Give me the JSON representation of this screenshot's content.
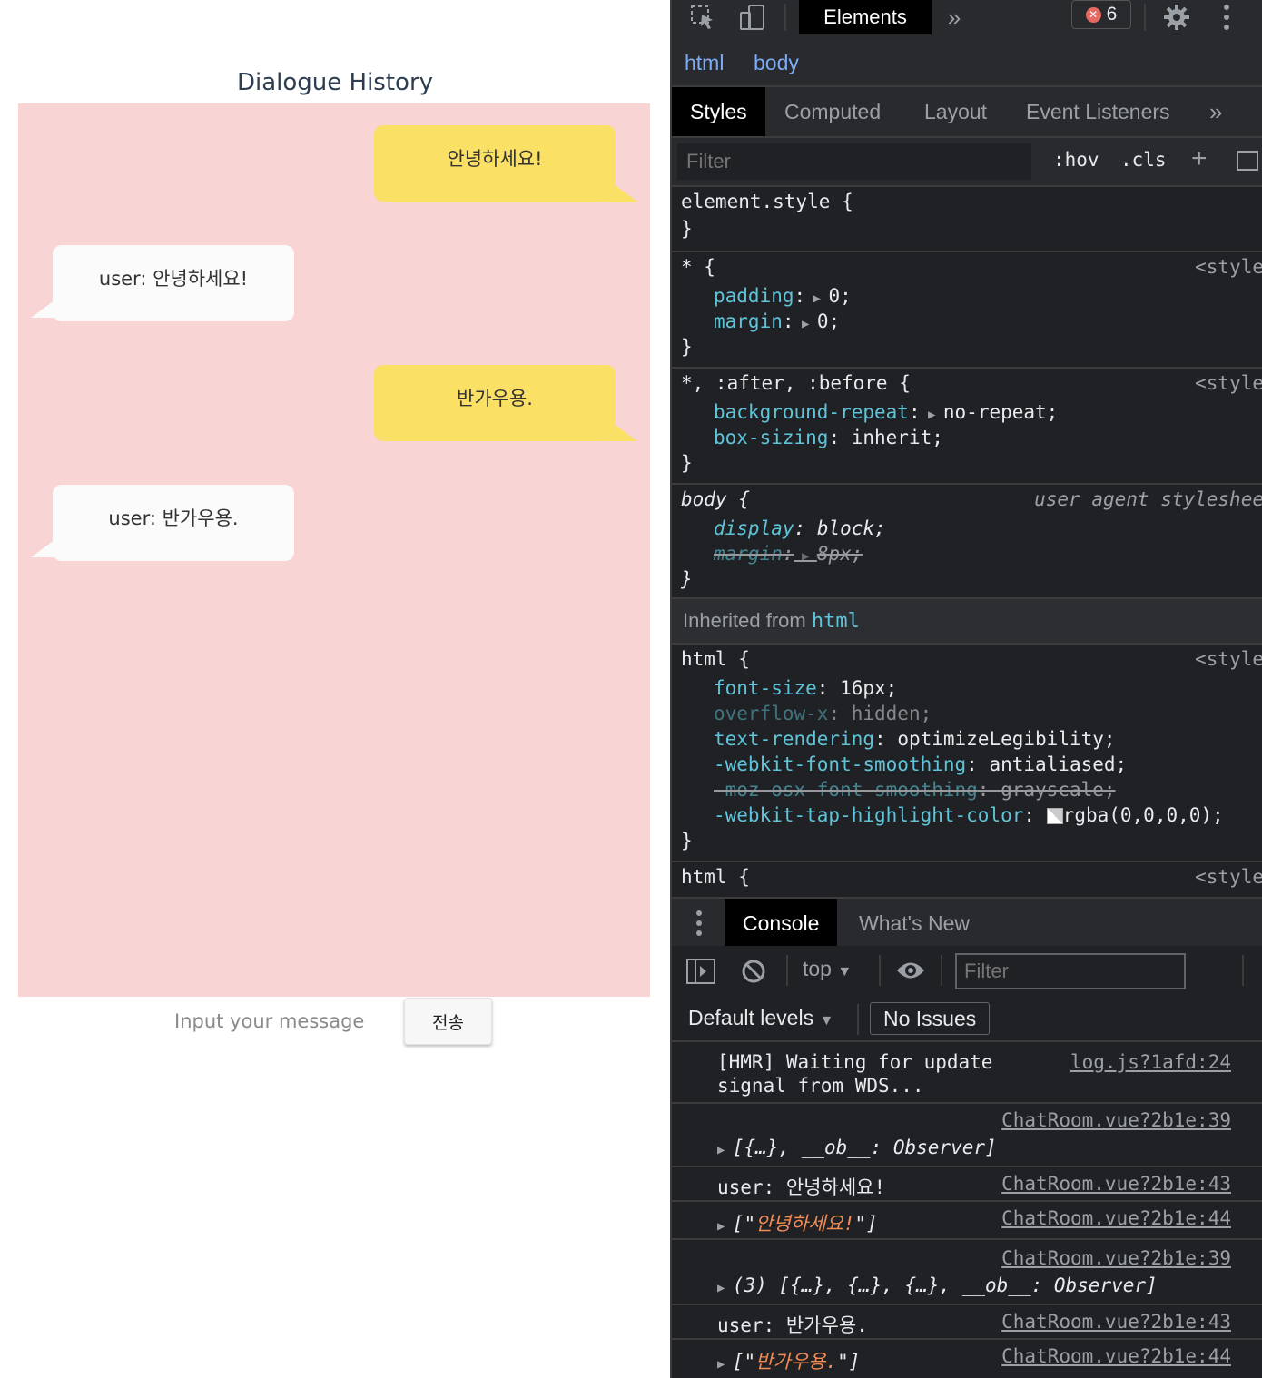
{
  "app": {
    "title": "Dialogue History",
    "messages": [
      {
        "side": "mine",
        "text": "안녕하세요!"
      },
      {
        "side": "other",
        "text": "user: 안녕하세요!"
      },
      {
        "side": "mine",
        "text": "반가우용."
      },
      {
        "side": "other",
        "text": "user: 반가우용."
      }
    ],
    "input_placeholder": "Input your message",
    "send_label": "전송",
    "colors": {
      "chat_bg": "#f8d4d4",
      "mine_bubble": "#fae165",
      "other_bubble": "#fbfbfb"
    }
  },
  "devtools": {
    "top_tabs": {
      "elements": "Elements",
      "more": "»"
    },
    "error_count": "6",
    "breadcrumb": [
      "html",
      "body"
    ],
    "subtabs": [
      "Styles",
      "Computed",
      "Layout",
      "Event Listeners",
      "»"
    ],
    "styles_filter_placeholder": "Filter",
    "hov": ":hov",
    "cls": ".cls",
    "plus": "+",
    "rules": {
      "element_style": {
        "selector": "element.style {",
        "close": "}"
      },
      "star": {
        "selector": "* {",
        "src": "<style",
        "p1": "padding",
        "v1": "0;",
        "p2": "margin",
        "v2": "0;",
        "close": "}"
      },
      "after_before": {
        "selector": "*, :after, :before {",
        "src": "<style",
        "p1": "background-repeat",
        "v1": "no-repeat;",
        "p2": "box-sizing",
        "v2": "inherit;",
        "close": "}"
      },
      "body": {
        "selector": "body {",
        "src": "user agent styleshee",
        "p1": "display",
        "v1": "block;",
        "p2": "margin",
        "v2": "8px;",
        "close": "}"
      },
      "inherited_label": "Inherited from",
      "inherited_tag": "html",
      "html1": {
        "selector": "html {",
        "src": "<style",
        "p1": "font-size",
        "v1": "16px;",
        "p2": "overflow-x",
        "v2": "hidden;",
        "p3": "text-rendering",
        "v3": "optimizeLegibility;",
        "p4": "-webkit-font-smoothing",
        "v4": "antialiased;",
        "p5": "-moz-osx-font-smoothing",
        "v5": "grayscale;",
        "p6": "-webkit-tap-highlight-color",
        "v6": "rgba(0,0,0,0);",
        "close": "}"
      },
      "html2": {
        "selector": "html {",
        "src": "<style"
      }
    },
    "console_tabs": [
      "Console",
      "What's New"
    ],
    "context": "top",
    "console_filter_placeholder": "Filter",
    "default_levels": "Default levels",
    "no_issues": "No Issues",
    "console_messages": [
      {
        "line1": "[HMR] Waiting for update",
        "line2": "signal from WDS...",
        "src": "log.js?1afd:24"
      },
      {
        "src": "ChatRoom.vue?2b1e:39",
        "text": "[{…}, __ob__: Observer]"
      },
      {
        "text": "user: 안녕하세요!",
        "src": "ChatRoom.vue?2b1e:43"
      },
      {
        "open": "[\"",
        "str": "안녕하세요!",
        "close": "\"]",
        "src": "ChatRoom.vue?2b1e:44"
      },
      {
        "src": "ChatRoom.vue?2b1e:39",
        "text": "(3) [{…}, {…}, {…}, __ob__: Observer]"
      },
      {
        "text": "user: 반가우용.",
        "src": "ChatRoom.vue?2b1e:43"
      },
      {
        "open": "[\"",
        "str": "반가우용.",
        "close": "\"]",
        "src": "ChatRoom.vue?2b1e:44"
      }
    ]
  }
}
